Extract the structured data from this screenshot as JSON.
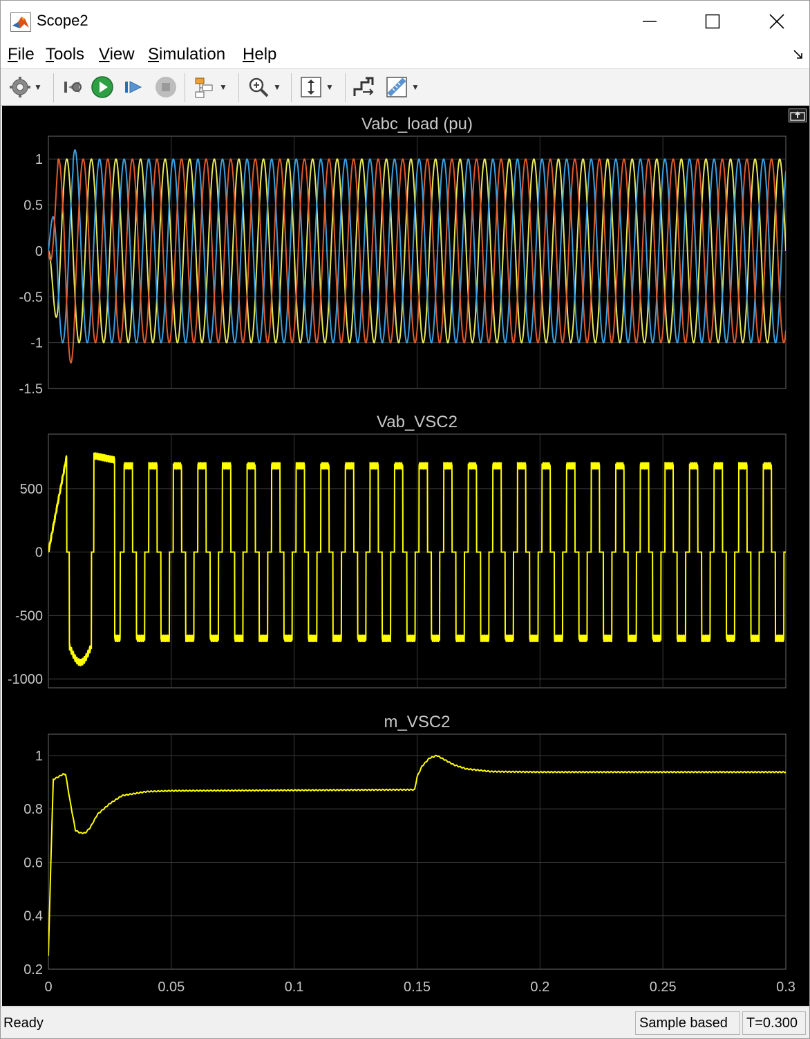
{
  "window": {
    "title": "Scope2"
  },
  "menu": [
    "File",
    "Tools",
    "View",
    "Simulation",
    "Help"
  ],
  "toolbar": {
    "icons": [
      "settings-icon",
      "step-back-icon",
      "run-icon",
      "step-forward-icon",
      "stop-icon",
      "highlight-block-icon",
      "zoom-icon",
      "autoscale-icon",
      "write-data-icon",
      "measurement-icon"
    ]
  },
  "colors": {
    "background": "#000000",
    "axes": "#000000",
    "grid": "#3a3a3a",
    "axis_text": "#c8c8c8",
    "phase_a": "#ffff00",
    "phase_b": "#0072bd",
    "phase_c": "#d95319"
  },
  "chart_data": [
    {
      "type": "line",
      "title": "Vabc_load (pu)",
      "xlim": [
        0,
        0.3
      ],
      "ylim": [
        -1.5,
        1.25
      ],
      "yticks": [
        "1",
        "0.5",
        "0",
        "-0.5",
        "-1",
        "-1.5"
      ],
      "xticks": [
        "0",
        "0.05",
        "0.1",
        "0.15",
        "0.2",
        "0.25",
        "0.3"
      ],
      "grid": true,
      "series": [
        {
          "color": "#e8e85a",
          "amplitude": 1.0,
          "frequency_hz": 100,
          "phase_deg": 0
        },
        {
          "color": "#3aa0e0",
          "amplitude": 1.0,
          "frequency_hz": 100,
          "phase_deg": -120,
          "initial_peak": 1.1
        },
        {
          "color": "#e05a2a",
          "amplitude": 1.0,
          "frequency_hz": 100,
          "phase_deg": 120,
          "initial_trough": -1.22
        }
      ]
    },
    {
      "type": "line",
      "title": "Vab_VSC2",
      "xlim": [
        0,
        0.3
      ],
      "ylim": [
        -1070,
        930
      ],
      "yticks": [
        "500",
        "0",
        "-500",
        "-1000"
      ],
      "xticks": [
        "0",
        "0.05",
        "0.1",
        "0.15",
        "0.2",
        "0.25",
        "0.3"
      ],
      "grid": true,
      "series": [
        {
          "color": "#ffff00",
          "waveform": "square",
          "frequency_hz": 100,
          "amplitude_steady": 680,
          "initial_peak": 760,
          "initial_trough": -870
        }
      ]
    },
    {
      "type": "line",
      "title": "m_VSC2",
      "xlim": [
        0,
        0.3
      ],
      "ylim": [
        0.2,
        1.08
      ],
      "yticks": [
        "1",
        "0.8",
        "0.6",
        "0.4",
        "0.2"
      ],
      "xticks": [
        "0",
        "0.05",
        "0.1",
        "0.15",
        "0.2",
        "0.25",
        "0.3"
      ],
      "grid": true,
      "series": [
        {
          "color": "#ffff00",
          "x": [
            0,
            0.001,
            0.002,
            0.004,
            0.006,
            0.007,
            0.009,
            0.011,
            0.013,
            0.015,
            0.017,
            0.02,
            0.025,
            0.03,
            0.04,
            0.05,
            0.1,
            0.149,
            0.15,
            0.152,
            0.155,
            0.158,
            0.16,
            0.165,
            0.17,
            0.18,
            0.2,
            0.25,
            0.3
          ],
          "y": [
            0.25,
            0.6,
            0.91,
            0.92,
            0.93,
            0.93,
            0.82,
            0.72,
            0.71,
            0.71,
            0.73,
            0.78,
            0.82,
            0.85,
            0.865,
            0.868,
            0.87,
            0.872,
            0.92,
            0.96,
            0.99,
            1.0,
            0.99,
            0.965,
            0.95,
            0.94,
            0.938,
            0.938,
            0.938
          ]
        }
      ]
    }
  ],
  "status": {
    "ready": "Ready",
    "mode": "Sample based",
    "time": "T=0.300"
  }
}
